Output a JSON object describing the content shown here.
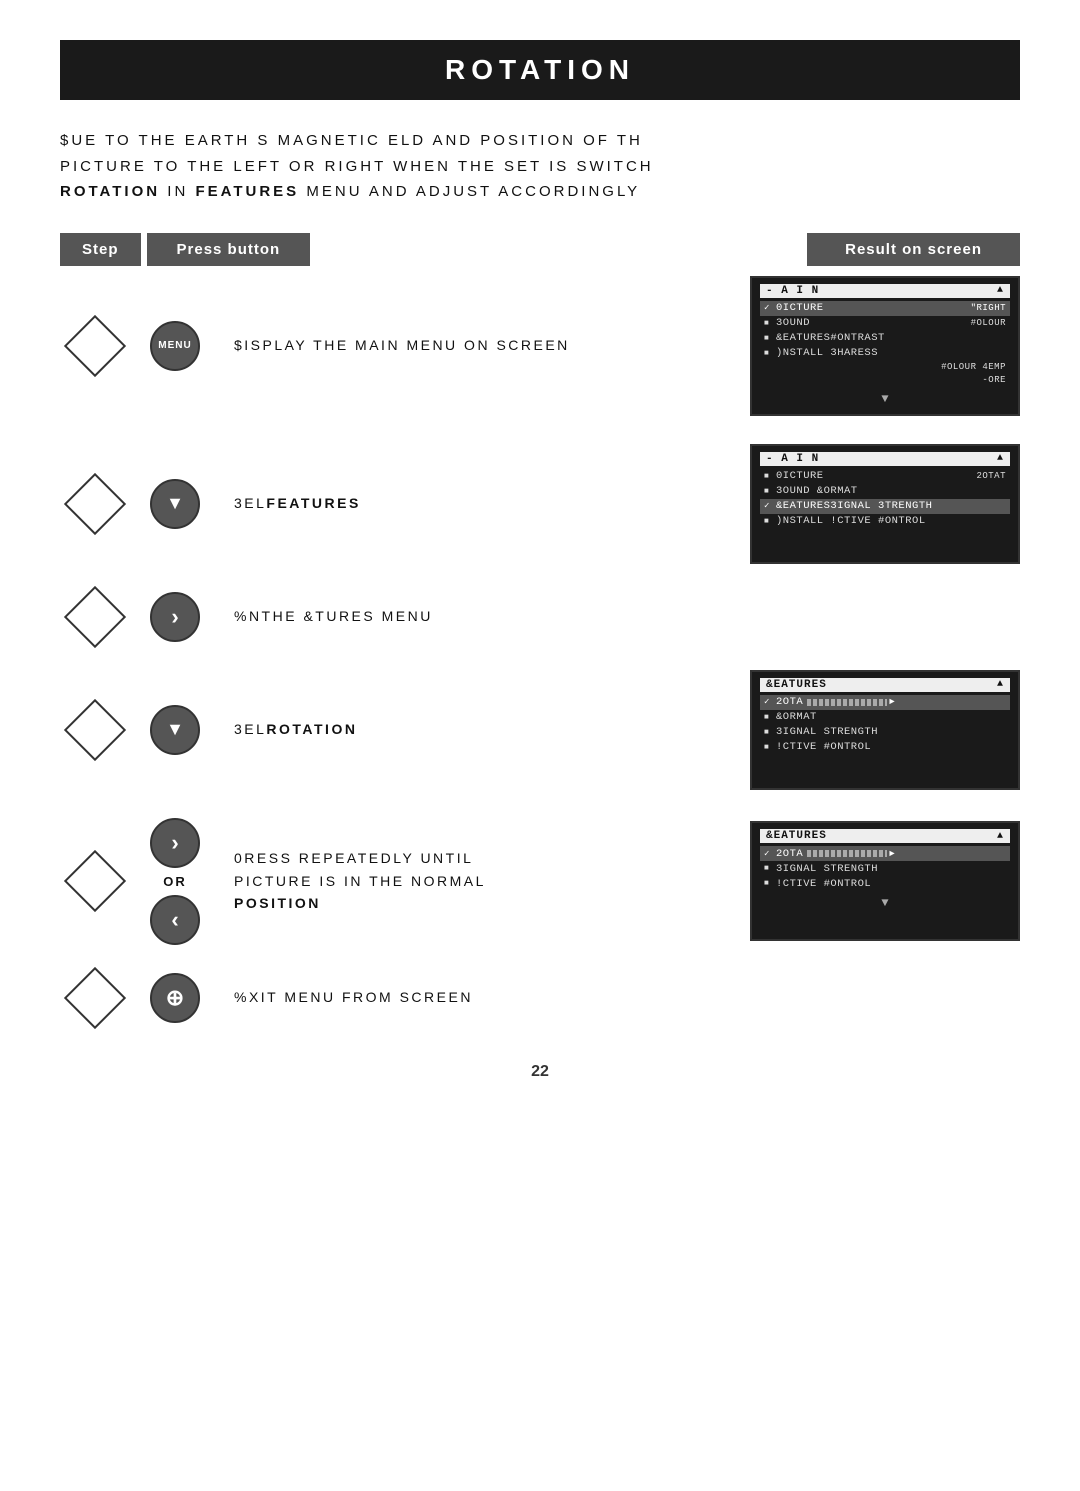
{
  "page": {
    "title": "ROTATION",
    "number": "22"
  },
  "intro": {
    "line1": "$UE TO THE EARTH S MAGNETIC  ELD AND POSITION OF TH",
    "line2": "PICTURE TO THE LEFT OR RIGHT WHEN THE SET IS SWITCH",
    "line3_bold1": "Rotation",
    "line3_mid": " IN ",
    "line3_bold2": "Features",
    "line3_rest": " MENU AND ADJUST ACCORDINGLY"
  },
  "header": {
    "step_label": "Step",
    "press_label": "Press button",
    "result_label": "Result on screen"
  },
  "steps": [
    {
      "id": 1,
      "button_type": "menu",
      "button_label": "MENU",
      "instruction": "$ISPLAY THE MAIN MENU ON SCREEN",
      "screen": {
        "header": "- A I N",
        "items": [
          {
            "type": "check",
            "label": "0ICTURE",
            "side": "\"RIGHT"
          },
          {
            "type": "bullet",
            "label": "3OUND",
            "side": "#OLOUR"
          },
          {
            "type": "bullet",
            "label": "&EATURES#ONTRAST"
          },
          {
            "type": "bullet",
            "label": ")NSTALL 3HARESS"
          },
          {
            "type": "none",
            "label": "",
            "side": "#OLOUR 4EMP"
          },
          {
            "type": "none",
            "label": "",
            "side": "-ORE"
          }
        ],
        "has_bottom_arrow": true
      }
    },
    {
      "id": 2,
      "button_type": "down",
      "button_label": "▼",
      "instruction": "3EL",
      "instruction_bold": "Features",
      "screen": {
        "header": "- A I N",
        "items": [
          {
            "type": "bullet",
            "label": "0ICTURE",
            "side": "2OTAT"
          },
          {
            "type": "bullet",
            "label": "3OUND    &ORMAT"
          },
          {
            "type": "check",
            "label": "&EATURES3IGNAL 3TRENGTH"
          },
          {
            "type": "bullet",
            "label": ")NSTALL  !CTIVE #ONTROL"
          }
        ],
        "has_bottom_arrow": false
      }
    },
    {
      "id": 3,
      "button_type": "right",
      "button_label": "›",
      "instruction": "%NTHE &TURES MENU",
      "screen": null
    },
    {
      "id": 4,
      "button_type": "down",
      "button_label": "▼",
      "instruction": "3EL",
      "instruction_bold": "Rotation",
      "screen": {
        "header": "&EATURES",
        "items": [
          {
            "type": "check_bar",
            "label": "2OTA",
            "has_bar": true
          },
          {
            "type": "bullet",
            "label": "&ORMAT"
          },
          {
            "type": "bullet",
            "label": "3IGNAL STRENGTH"
          },
          {
            "type": "bullet",
            "label": "!CTIVE #ONTROL"
          }
        ],
        "has_bottom_arrow": false
      }
    },
    {
      "id": 5,
      "button_type": "right_left",
      "button_label_top": "›",
      "button_label_bottom": "‹",
      "or_label": "OR",
      "instruction_line1": "0RESS REPEATEDLY UNTIL",
      "instruction_line2": "PICTURE IS IN THE NORMAL",
      "instruction_bold": "POSITION",
      "screen": {
        "header": "&EATURES",
        "items": [
          {
            "type": "check_bar",
            "label": "2OTA",
            "has_bar": true
          },
          {
            "type": "bullet",
            "label": "3IGNAL STRENGTH"
          },
          {
            "type": "bullet",
            "label": "!CTIVE #ONTROL"
          }
        ],
        "has_bottom_arrow": true
      }
    },
    {
      "id": 6,
      "button_type": "info",
      "button_label": "ⓘ",
      "instruction": "%XIT MENU FROM SCREEN",
      "screen": null
    }
  ]
}
